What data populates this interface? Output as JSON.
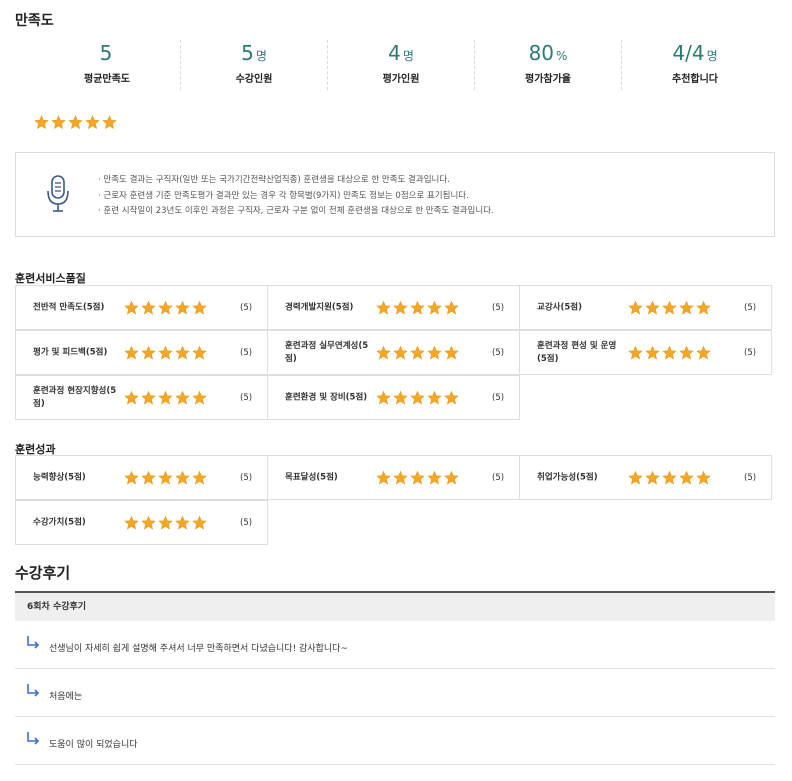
{
  "satisfaction": {
    "title": "만족도",
    "summary": [
      {
        "value": "5",
        "unit": "",
        "label": "평균만족도"
      },
      {
        "value": "5",
        "unit": "명",
        "label": "수강인원"
      },
      {
        "value": "4",
        "unit": "명",
        "label": "평가인원"
      },
      {
        "value": "80",
        "unit": "%",
        "label": "평가참가율"
      },
      {
        "value": "4/4",
        "unit": "명",
        "label": "추천합니다"
      }
    ],
    "overall_rating": 5,
    "max_rating": 5,
    "notice": [
      "· 만족도 결과는 구직자(일반 또는 국가기간전략산업직종) 훈련생을 대상으로 한 만족도 결과입니다.",
      "· 근로자 훈련생 기준 만족도평가 결과만 있는 경우 각 항목별(9가지) 만족도 정보는 0점으로 표기됩니다.",
      "· 훈련 시작일이 23년도 이후인 과정은 구직자, 근로자 구분 없이 전체 훈련생을 대상으로 한 만족도 결과입니다."
    ]
  },
  "service_quality": {
    "title": "훈련서비스품질",
    "items": [
      {
        "name": "전반적 만족도(5점)",
        "score": "(5)",
        "rating": 5
      },
      {
        "name": "경력개발지원(5점)",
        "score": "(5)",
        "rating": 5
      },
      {
        "name": "교강사(5점)",
        "score": "(5)",
        "rating": 5
      },
      {
        "name": "평가 및 피드백(5점)",
        "score": "(5)",
        "rating": 5
      },
      {
        "name": "훈련과정 실무연계성(5점)",
        "score": "(5)",
        "rating": 5
      },
      {
        "name": "훈련과정 편성 및 운영(5점)",
        "score": "(5)",
        "rating": 5
      },
      {
        "name": "훈련과정 현장지향성(5점)",
        "score": "(5)",
        "rating": 5
      },
      {
        "name": "훈련환경 및 장비(5점)",
        "score": "(5)",
        "rating": 5
      }
    ]
  },
  "training_outcome": {
    "title": "훈련성과",
    "items": [
      {
        "name": "능력향상(5점)",
        "score": "(5)",
        "rating": 5
      },
      {
        "name": "목표달성(5점)",
        "score": "(5)",
        "rating": 5
      },
      {
        "name": "취업가능성(5점)",
        "score": "(5)",
        "rating": 5
      },
      {
        "name": "수강가치(5점)",
        "score": "(5)",
        "rating": 5
      }
    ]
  },
  "reviews": {
    "title": "수강후기",
    "header": "6회차 수강후기",
    "items": [
      "선생님이 자세히 쉽게 설명해 주셔서 너무 만족하면서 다녔습니다! 감사합니다~",
      "처음에는",
      "도움이 많이 되었습니다"
    ]
  },
  "colors": {
    "accent": "#2c7a75",
    "star": "#f5a623",
    "arrow": "#3b6fd4"
  },
  "icons": {
    "star": "star-icon",
    "mic": "microphone-icon",
    "reply": "reply-arrow-icon"
  }
}
